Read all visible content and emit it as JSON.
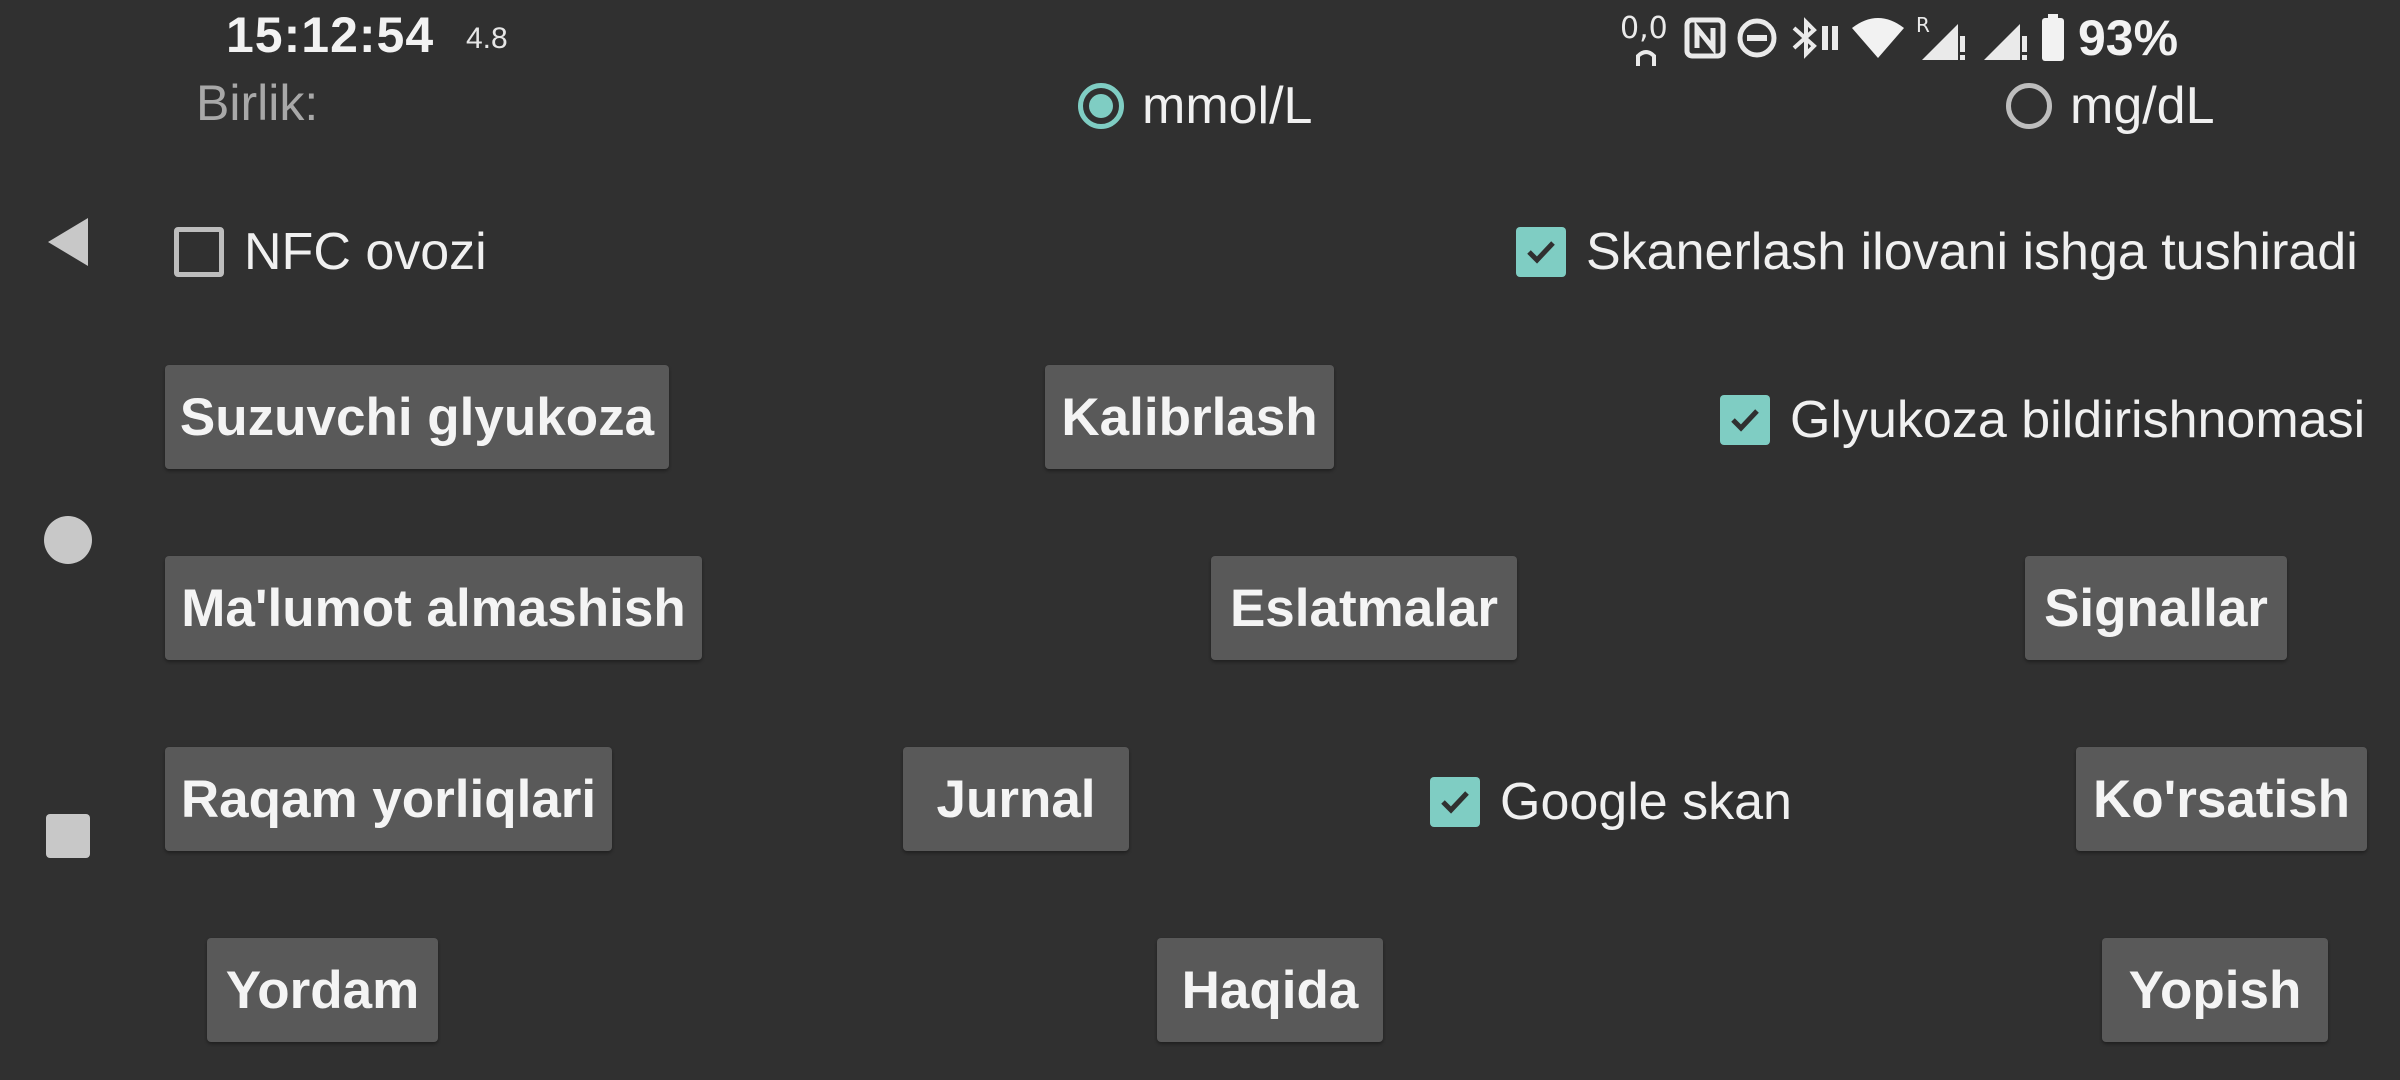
{
  "status_bar": {
    "time": "15:12:54",
    "net_speed": "4.8",
    "battery_percent": "93%",
    "icons": [
      "cloud-sync-icon",
      "nfc-icon",
      "do-not-disturb-icon",
      "bluetooth-icon",
      "wifi-icon",
      "signal-roaming-icon",
      "signal-icon",
      "battery-icon"
    ]
  },
  "navigation_bar": {
    "icons": [
      "back-icon",
      "home-icon",
      "recents-icon"
    ]
  },
  "units": {
    "label": "Birlik:",
    "options": [
      {
        "label": "mmol/L",
        "selected": true
      },
      {
        "label": "mg/dL",
        "selected": false
      }
    ]
  },
  "checkboxes": {
    "nfc_sound": {
      "label": "NFC ovozi",
      "checked": false
    },
    "scan_launches_app": {
      "label": "Skanerlash ilovani ishga tushiradi",
      "checked": true
    },
    "glucose_notification": {
      "label": "Glyukoza bildirishnomasi",
      "checked": true
    },
    "google_scan": {
      "label": "Google skan",
      "checked": true
    }
  },
  "buttons": {
    "floating_glucose": "Suzuvchi glyukoza",
    "calibration": "Kalibrlash",
    "data_exchange": "Ma'lumot almashish",
    "reminders": "Eslatmalar",
    "alarms": "Signallar",
    "number_labels": "Raqam yorliqlari",
    "log": "Jurnal",
    "show": "Ko'rsatish",
    "help": "Yordam",
    "about": "Haqida",
    "close": "Yopish"
  },
  "colors": {
    "background": "#303030",
    "accent": "#7fcdc3",
    "button": "#595959",
    "muted_text": "#a8a8a8"
  }
}
